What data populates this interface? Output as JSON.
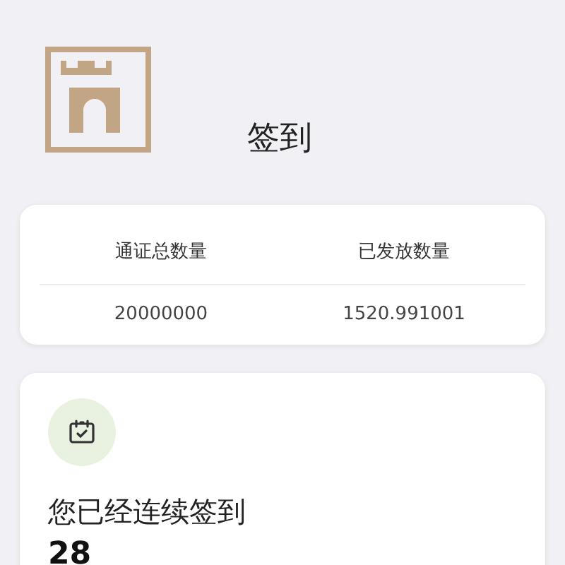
{
  "header": {
    "title": "签到"
  },
  "stats": {
    "columns": [
      "通证总数量",
      "已发放数量"
    ],
    "values": [
      "20000000",
      "1520.991001"
    ]
  },
  "checkin": {
    "label": "您已经连续签到",
    "days": "28"
  }
}
